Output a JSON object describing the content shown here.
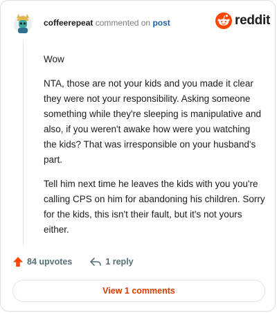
{
  "header": {
    "username": "coffeerepeat",
    "action_text": "commented on",
    "post_link": "post",
    "brand": "reddit"
  },
  "comment": {
    "paragraphs": [
      "Wow",
      "NTA, those are not your kids and you made it clear they were not your responsibility. Asking someone something while they're sleeping is manipulative and also, if you weren't awake how were you watching the kids? That was irresponsible on your husband's part.",
      "Tell him next time he leaves the kids with you you're calling CPS on him for abandoning his children. Sorry for the kids, this isn't their fault, but it's not yours either."
    ]
  },
  "actions": {
    "upvotes": "84 upvotes",
    "replies": "1 reply"
  },
  "footer": {
    "view_comments": "View 1 comments"
  },
  "colors": {
    "accent": "#ff4500",
    "link": "#1a5da6",
    "view_button_text": "#d93a00"
  },
  "icons": [
    "user-avatar",
    "reddit-logo-icon",
    "upvote-arrow-icon",
    "reply-arrow-icon"
  ]
}
